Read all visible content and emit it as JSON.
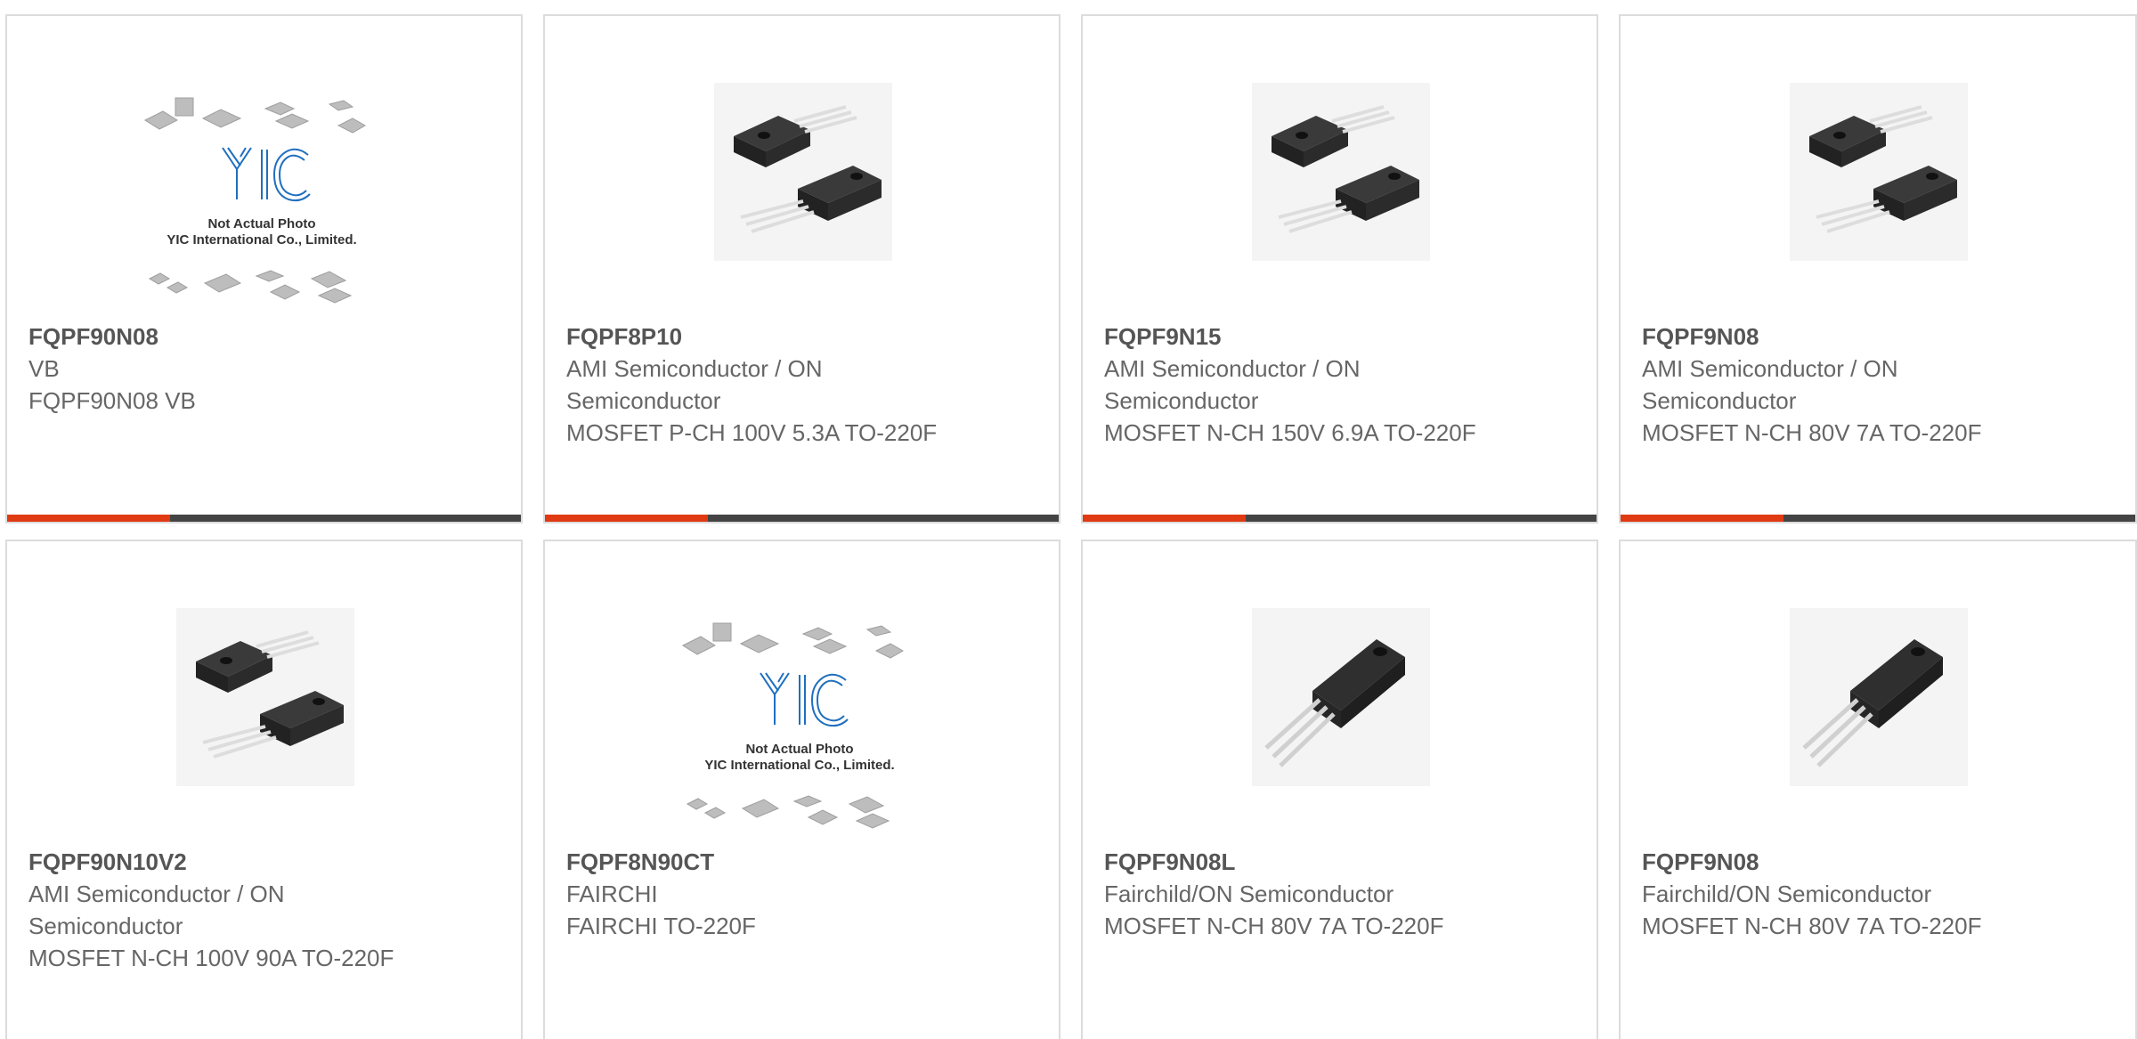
{
  "products": [
    {
      "part_number": "FQPF90N08",
      "manufacturer": "VB",
      "description": "FQPF90N08 VB",
      "image": "yic-placeholder",
      "placeholder_line1": "Not Actual Photo",
      "placeholder_line2": "YIC International Co., Limited.",
      "placeholder_logo": "YIC",
      "has_accent_bar": true
    },
    {
      "part_number": "FQPF8P10",
      "manufacturer": "AMI Semiconductor / ON Semiconductor",
      "description": "MOSFET P-CH 100V 5.3A TO-220F",
      "image": "to220f-pair",
      "has_accent_bar": true
    },
    {
      "part_number": "FQPF9N15",
      "manufacturer": "AMI Semiconductor / ON Semiconductor",
      "description": "MOSFET N-CH 150V 6.9A TO-220F",
      "image": "to220f-pair",
      "has_accent_bar": true
    },
    {
      "part_number": "FQPF9N08",
      "manufacturer": "AMI Semiconductor / ON Semiconductor",
      "description": "MOSFET N-CH 80V 7A TO-220F",
      "image": "to220f-pair",
      "has_accent_bar": true
    },
    {
      "part_number": "FQPF90N10V2",
      "manufacturer": "AMI Semiconductor / ON Semiconductor",
      "description": "MOSFET N-CH 100V 90A TO-220F",
      "image": "to220f-pair",
      "has_accent_bar": false
    },
    {
      "part_number": "FQPF8N90CT",
      "manufacturer": "FAIRCHI",
      "description": "FAIRCHI TO-220F",
      "image": "yic-placeholder",
      "placeholder_line1": "Not Actual Photo",
      "placeholder_line2": "YIC International Co., Limited.",
      "placeholder_logo": "YIC",
      "has_accent_bar": false
    },
    {
      "part_number": "FQPF9N08L",
      "manufacturer": "Fairchild/ON Semiconductor",
      "description": "MOSFET N-CH 80V 7A TO-220F",
      "image": "to220f-single",
      "has_accent_bar": false
    },
    {
      "part_number": "FQPF9N08",
      "manufacturer": "Fairchild/ON Semiconductor",
      "description": "MOSFET N-CH 80V 7A TO-220F",
      "image": "to220f-single",
      "has_accent_bar": false
    }
  ],
  "colors": {
    "accent": "#e03a13",
    "bar": "#444444",
    "border": "#dcdcdc",
    "title_text": "#555555",
    "body_text": "#666666",
    "logo_blue": "#1f6fbf"
  }
}
